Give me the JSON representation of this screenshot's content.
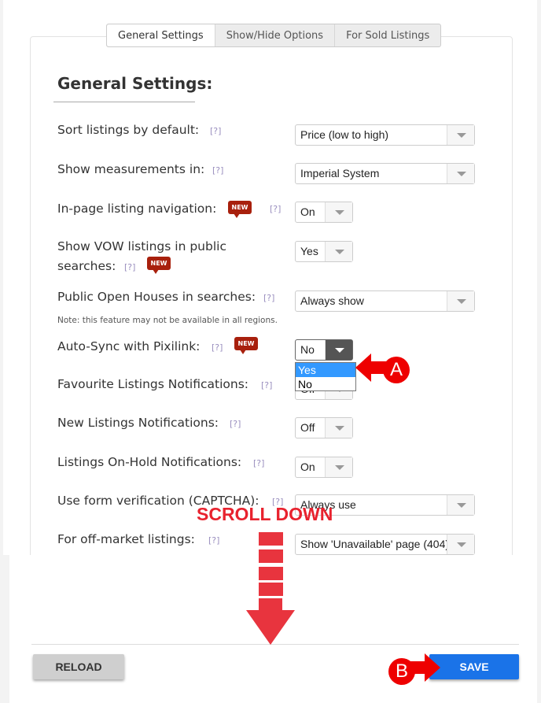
{
  "tabs": [
    "General Settings",
    "Show/Hide Options",
    "For Sold Listings"
  ],
  "heading": "General Settings:",
  "help": "[?]",
  "new_badge": "NEW",
  "settings": [
    {
      "label": "Sort listings by default:",
      "value": "Price (low to high)"
    },
    {
      "label": "Show measurements in:",
      "value": "Imperial System"
    },
    {
      "label": "In-page listing navigation:",
      "value": "On"
    },
    {
      "label": "Show VOW listings in public",
      "label2": "searches:",
      "value": "Yes"
    },
    {
      "label": "Public Open Houses in searches:",
      "value": "Always show",
      "note": "Note: this feature may not be available in all regions."
    },
    {
      "label": "Auto-Sync with Pixilink:",
      "value": "No",
      "options": [
        "Yes",
        "No"
      ]
    },
    {
      "label": "Favourite Listings Notifications:",
      "value": "Off"
    },
    {
      "label": "New Listings Notifications:",
      "value": "Off"
    },
    {
      "label": "Listings On-Hold Notifications:",
      "value": "On"
    },
    {
      "label": "Use form verification (CAPTCHA):",
      "value": "Always use"
    },
    {
      "label": "For off-market listings:",
      "value": "Show 'Unavailable' page (404)"
    }
  ],
  "buttons": {
    "reload": "RELOAD",
    "save": "SAVE"
  },
  "annotations": {
    "scroll": "SCROLL DOWN",
    "a": "A",
    "b": "B",
    "color": "#e8222e"
  }
}
